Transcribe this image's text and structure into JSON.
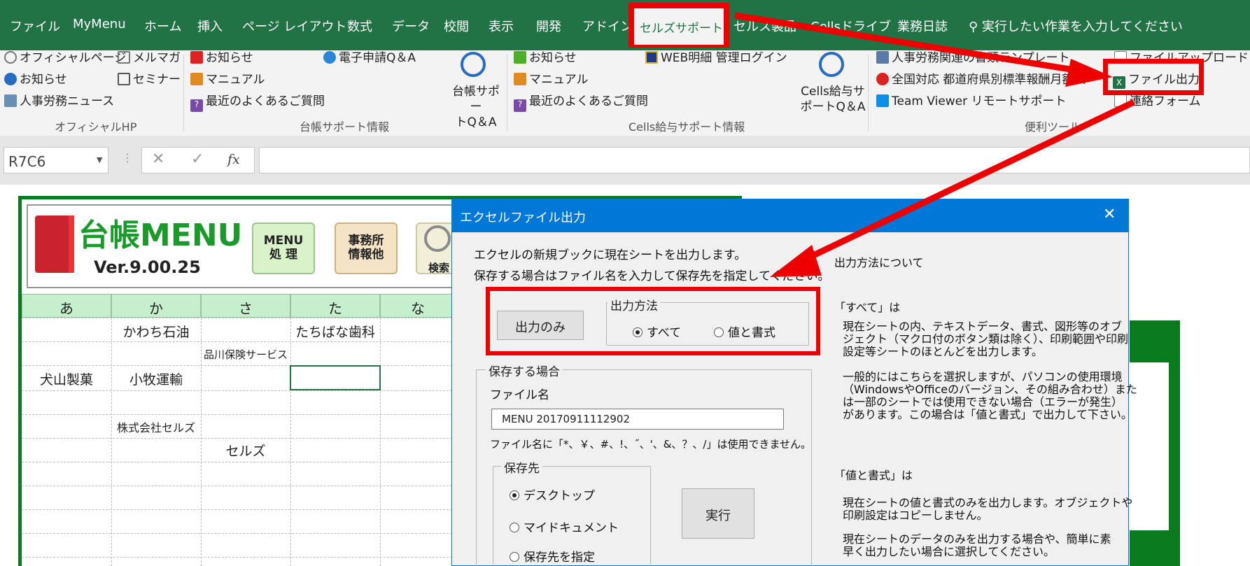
{
  "tabs": [
    "ファイル",
    "MyMenu",
    "ホーム",
    "挿入",
    "ページ レイアウト",
    "数式",
    "データ",
    "校閲",
    "表示",
    "開発",
    "アドイン",
    "セルズサポート",
    "セルス製品",
    "Cellsドライブ",
    "業務日誌"
  ],
  "tell_me": "実行したい作業を入力してください",
  "ribbon": {
    "official": {
      "items": [
        "オフィシャルページ",
        "お知らせ",
        "人事労務ニュース",
        "メルマガ",
        "セミナー"
      ],
      "label": "オフィシャルHP"
    },
    "daicho": {
      "items": [
        "お知らせ",
        "マニュアル",
        "最近のよくあるご質問",
        "電子申請Q＆A"
      ],
      "qa_line1": "台帳サポー",
      "qa_line2": "トQ＆A",
      "label": "台帳サポート情報"
    },
    "cells": {
      "items": [
        "お知らせ",
        "マニュアル",
        "最近のよくあるご質問",
        "WEB明細 管理ログイン"
      ],
      "qa_line1": "Cells給与サ",
      "qa_line2": "ポートQ＆A",
      "label": "Cells給与サポート情報"
    },
    "benri": {
      "items": [
        "人事労務関連の書類テンプレート",
        "全国対応 都道府県別標準報酬月額表",
        "Team Viewer リモートサポート",
        "ファイルアップロード",
        "ファイル出力",
        "連絡フォーム"
      ],
      "label": "便利ツール"
    }
  },
  "namebox": "R7C6",
  "fx": "fx",
  "sheet": {
    "title": "台帳MENU",
    "version": "Ver.9.00.25",
    "menu_btn": "MENU\n処 理",
    "office_btn": "事務所\n情報他",
    "search_btn": "検索",
    "columns": [
      "あ",
      "か",
      "さ",
      "た",
      "な"
    ],
    "cells": {
      "r1c2": "かわち石油",
      "r1c4": "たちばな歯科",
      "r2c3": "品川保険サービス",
      "r3c1": "犬山製菓",
      "r3c2": "小牧運輸",
      "r5c2": "株式会社セルズ",
      "r6c3": "セルズ"
    }
  },
  "dialog": {
    "title": "エクセルファイル出力",
    "intro1": "エクセルの新規ブックに現在シートを出力します。",
    "intro2": "保存する場合はファイル名を入力して保存先を指定してください。",
    "output_only": "出力のみ",
    "method_legend": "出力方法",
    "opt_all": "すべて",
    "opt_values": "値と書式",
    "save_legend": "保存する場合",
    "filename_label": "ファイル名",
    "filename_value": "MENU 20170911112902",
    "filename_note": "ファイル名に「*、￥、#、!、˝、'、&、？、/」は使用できません。",
    "dest_legend": "保存先",
    "dest_desktop": "デスクトップ",
    "dest_mydocs": "マイドキュメント",
    "dest_custom": "保存先を指定",
    "run": "実行",
    "about": "出力方法について",
    "all_head": "「すべて」は",
    "all_desc1": "現在シートの内、テキストデータ、書式、図形等のオブ\nジェクト（マクロ付のボタン類は除く）、印刷範囲や印刷\n設定等シートのほとんどを出力します。",
    "all_desc2": "一般的にはこちらを選択しますが、パソコンの使用環境\n（WindowsやOfficeのバージョン、その組み合わせ）また\nは一部のシートでは使用できない場合（エラーが発生）\nがあります。この場合は「値と書式」で出力して下さい。",
    "val_head": "「値と書式」は",
    "val_desc1": "現在シートの値と書式のみを出力します。オブジェクトや\n印刷設定はコピーしません。",
    "val_desc2": "現在シートのデータのみを出力する場合や、簡単に素\n早く出力したい場合に選択してください。"
  },
  "colors": {
    "excel_green": "#217346",
    "annotation_red": "#e00000",
    "dialog_blue": "#0078d7"
  }
}
